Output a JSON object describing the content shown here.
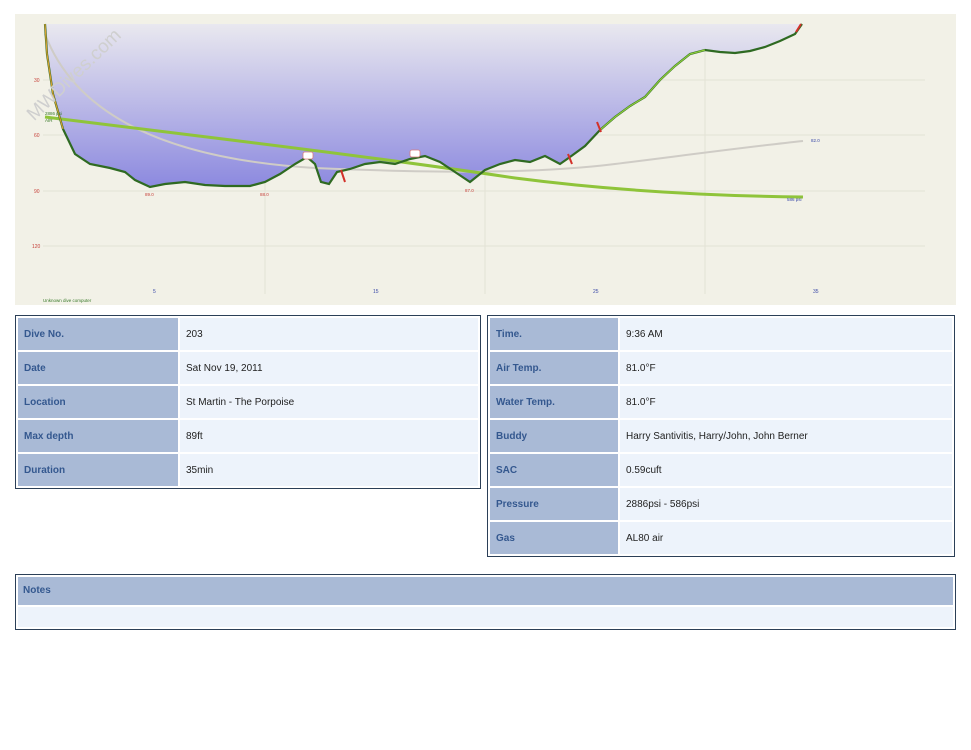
{
  "profile": {
    "watermark": "MWDives.com",
    "y_ticks": [
      "30",
      "60",
      "90",
      "120"
    ],
    "x_ticks": [
      "5",
      "15",
      "25",
      "35"
    ],
    "depth_markers": [
      "89.0",
      "88.0",
      "87.0"
    ],
    "start_pressure_label": "2886 psi",
    "gas_label": "AIR",
    "end_pressure_label": "586 psi",
    "temp_label": "82.0",
    "computer_label": "Unknown dive computer",
    "colors": {
      "background": "#f2f1e7",
      "depth_fill_top": "#e9e8ef",
      "depth_fill_bottom": "#8c89df",
      "pressure_line": "#8fc43a",
      "depth_line": "#2f6a22",
      "temp_line": "#c9c6bf"
    }
  },
  "info_left": [
    {
      "label": "Dive No.",
      "value": "203"
    },
    {
      "label": "Date",
      "value": "Sat Nov 19, 2011"
    },
    {
      "label": "Location",
      "value": "St Martin - The Porpoise"
    },
    {
      "label": "Max depth",
      "value": "89ft"
    },
    {
      "label": "Duration",
      "value": "35min"
    }
  ],
  "info_right": [
    {
      "label": "Time.",
      "value": "9:36 AM"
    },
    {
      "label": "Air Temp.",
      "value": "81.0°F"
    },
    {
      "label": "Water Temp.",
      "value": "81.0°F"
    },
    {
      "label": "Buddy",
      "value": "Harry Santivitis, Harry/John, John Berner"
    },
    {
      "label": "SAC",
      "value": "0.59cuft"
    },
    {
      "label": "Pressure",
      "value": "2886psi - 586psi"
    },
    {
      "label": "Gas",
      "value": "AL80 air"
    }
  ],
  "notes": {
    "label": "Notes",
    "text": ""
  }
}
